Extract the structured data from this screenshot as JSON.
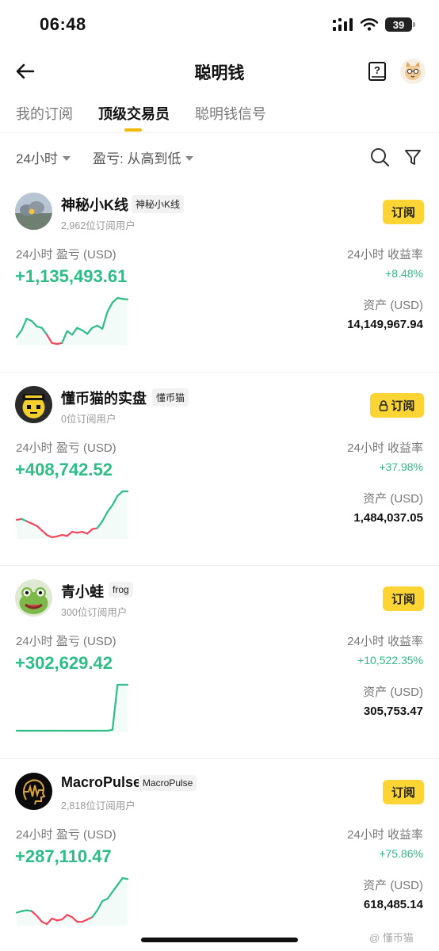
{
  "status_bar": {
    "time": "06:48",
    "battery": "39"
  },
  "header": {
    "title": "聪明钱"
  },
  "tabs": [
    {
      "label": "我的订阅",
      "active": false
    },
    {
      "label": "顶级交易员",
      "active": true
    },
    {
      "label": "聪明钱信号",
      "active": false
    }
  ],
  "filters": {
    "period": "24小时",
    "sort": "盈亏: 从高到低"
  },
  "labels": {
    "pnl": "24小时 盈亏 (USD)",
    "roi": "24小时 收益率",
    "assets": "资产 (USD)"
  },
  "traders": [
    {
      "name": "神秘小K线",
      "tag": "神秘小K线",
      "subscribers": "2,962位订阅用户",
      "button": "订阅",
      "locked": false,
      "pnl": "+1,135,493.61",
      "roi": "+8.48%",
      "assets": "14,149,967.94",
      "spark": [
        0.15,
        0.3,
        0.55,
        0.5,
        0.38,
        0.35,
        0.2,
        0.02,
        0.0,
        0.02,
        0.28,
        0.2,
        0.35,
        0.3,
        0.22,
        0.35,
        0.4,
        0.33,
        0.7,
        0.9,
        1.0,
        0.98,
        0.97
      ],
      "spark_colors": [
        "#2ebd85",
        "#2ebd85",
        "#2ebd85",
        "#2ebd85",
        "#2ebd85",
        "#2ebd85",
        "#f6465d",
        "#f6465d",
        "#f6465d",
        "#2ebd85",
        "#2ebd85",
        "#2ebd85",
        "#2ebd85",
        "#2ebd85",
        "#2ebd85",
        "#2ebd85",
        "#2ebd85",
        "#2ebd85",
        "#2ebd85",
        "#2ebd85",
        "#2ebd85",
        "#2ebd85"
      ]
    },
    {
      "name": "懂币猫的实盘",
      "tag": "懂币猫",
      "subscribers": "0位订阅用户",
      "button": "订阅",
      "locked": true,
      "pnl": "+408,742.52",
      "roi": "+37.98%",
      "assets": "1,484,037.05",
      "spark": [
        0.38,
        0.4,
        0.35,
        0.3,
        0.25,
        0.15,
        0.05,
        0.0,
        0.02,
        0.05,
        0.03,
        0.12,
        0.1,
        0.12,
        0.08,
        0.18,
        0.2,
        0.35,
        0.55,
        0.7,
        0.9,
        1.0,
        1.0
      ],
      "spark_colors": [
        "#f6465d",
        "#2ebd85",
        "#f6465d",
        "#f6465d",
        "#f6465d",
        "#f6465d",
        "#f6465d",
        "#f6465d",
        "#f6465d",
        "#f6465d",
        "#f6465d",
        "#f6465d",
        "#f6465d",
        "#f6465d",
        "#f6465d",
        "#f6465d",
        "#2ebd85",
        "#2ebd85",
        "#2ebd85",
        "#2ebd85",
        "#2ebd85",
        "#2ebd85"
      ]
    },
    {
      "name": "青小蛙",
      "tag": "frog",
      "subscribers": "300位订阅用户",
      "button": "订阅",
      "locked": false,
      "pnl": "+302,629.42",
      "roi": "+10,522.35%",
      "assets": "305,753.47",
      "spark": [
        0.0,
        0.0,
        0.0,
        0.0,
        0.0,
        0.0,
        0.0,
        0.0,
        0.0,
        0.0,
        0.0,
        0.0,
        0.0,
        0.0,
        0.0,
        0.0,
        0.0,
        0.0,
        0.0,
        0.02,
        1.0,
        1.0,
        1.0
      ],
      "spark_colors": [
        "#2ebd85",
        "#2ebd85",
        "#2ebd85",
        "#2ebd85",
        "#2ebd85",
        "#2ebd85",
        "#2ebd85",
        "#2ebd85",
        "#2ebd85",
        "#2ebd85",
        "#2ebd85",
        "#2ebd85",
        "#2ebd85",
        "#2ebd85",
        "#2ebd85",
        "#2ebd85",
        "#2ebd85",
        "#2ebd85",
        "#2ebd85",
        "#2ebd85",
        "#2ebd85",
        "#2ebd85"
      ]
    },
    {
      "name": "MacroPulse",
      "tag": "MacroPulse",
      "subscribers": "2,818位订阅用户",
      "button": "订阅",
      "locked": false,
      "pnl": "+287,110.47",
      "roi": "+75.86%",
      "assets": "618,485.14",
      "spark": [
        0.25,
        0.28,
        0.3,
        0.28,
        0.18,
        0.05,
        0.0,
        0.12,
        0.08,
        0.1,
        0.2,
        0.15,
        0.05,
        0.05,
        0.1,
        0.15,
        0.3,
        0.5,
        0.55,
        0.7,
        0.85,
        1.0,
        0.98
      ],
      "spark_colors": [
        "#2ebd85",
        "#2ebd85",
        "#2ebd85",
        "#f6465d",
        "#f6465d",
        "#f6465d",
        "#f6465d",
        "#f6465d",
        "#f6465d",
        "#f6465d",
        "#f6465d",
        "#f6465d",
        "#f6465d",
        "#f6465d",
        "#f6465d",
        "#2ebd85",
        "#2ebd85",
        "#2ebd85",
        "#2ebd85",
        "#2ebd85",
        "#2ebd85",
        "#2ebd85"
      ]
    }
  ],
  "colors": {
    "accent": "#fcd535",
    "profit": "#2ebd85",
    "loss": "#f6465d",
    "tab_indicator": "#f0b90b"
  },
  "icons": [
    "back-arrow-icon",
    "help-book-icon",
    "search-icon",
    "filter-funnel-icon",
    "lock-icon",
    "signal-icon",
    "wifi-icon"
  ],
  "watermark": "@ 懂币猫"
}
